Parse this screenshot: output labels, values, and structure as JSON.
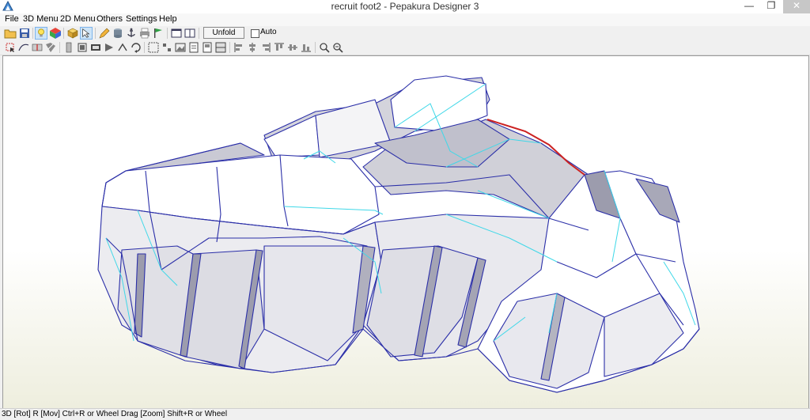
{
  "window": {
    "title": "recruit  foot2 - Pepakura Designer 3",
    "minimize_glyph": "—",
    "restore_glyph": "❐",
    "close_glyph": "✕"
  },
  "menu": {
    "items": [
      "File",
      "3D Menu",
      "2D Menu",
      "Others",
      "Settings",
      "Help"
    ]
  },
  "toolbar1": {
    "unfold_label": "Unfold",
    "auto_label": "Auto",
    "auto_checked": false
  },
  "status": {
    "text": "3D [Rot] R [Mov] Ctrl+R or Wheel Drag [Zoom] Shift+R or Wheel"
  },
  "colors": {
    "edge": "#2b2fa8",
    "fold": "#3fd8e8",
    "cut": "#cc2222",
    "face_light": "#ffffff",
    "face_shade": "#d2d2da",
    "face_dark": "#9c9cad"
  },
  "icons": {
    "toolbar1": [
      "open-folder-icon",
      "save-icon",
      "lightbulb-icon",
      "texture-cube-icon",
      "box-icon",
      "select-arrow-icon",
      "pencil-icon",
      "cylinder-icon",
      "anchor-icon",
      "print-icon",
      "flag-icon",
      "window-icon",
      "window-split-icon"
    ],
    "toolbar2": [
      "undo-select-icon",
      "edit-curve-icon",
      "cut-icon",
      "join-icon",
      "flap-icon",
      "split-icon",
      "rotate-icon",
      "move-icon",
      "fold-icon",
      "unfold-part-icon",
      "grid-icon",
      "text-icon",
      "image-icon",
      "page-icon",
      "align-left-icon",
      "align-center-icon",
      "align-right-icon",
      "align-top-icon",
      "align-middle-icon",
      "align-bottom-icon",
      "zoom-in-icon",
      "zoom-out-icon"
    ]
  }
}
